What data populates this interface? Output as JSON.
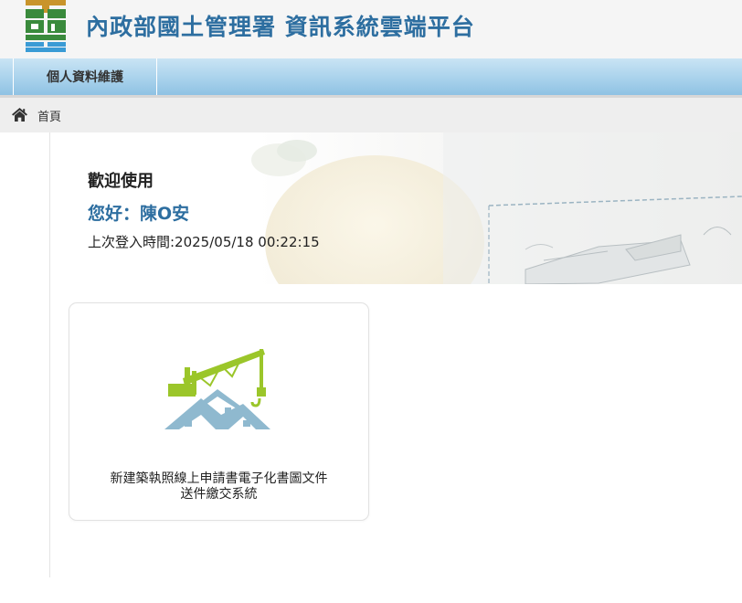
{
  "header": {
    "site_title": "內政部國土管理署 資訊系統雲端平台",
    "logo_icon": "ministry-logo-icon"
  },
  "nav": {
    "items": [
      {
        "label": "個人資料維護"
      }
    ]
  },
  "breadcrumb": {
    "home_icon": "home-icon",
    "home_label": "首頁"
  },
  "welcome": {
    "heading": "歡迎使用",
    "greeting": "您好：陳O安",
    "last_login": "上次登入時間:2025/05/18 00:22:15"
  },
  "systems": [
    {
      "icon": "construction-crane-house-icon",
      "title_line1": "新建築執照線上申請書電子化書圖文件",
      "title_line2": "送件繳交系統"
    }
  ],
  "colors": {
    "title_blue": "#2d6ea0",
    "nav_gradient_top": "#c9e4f4",
    "nav_gradient_bottom": "#8fc2e3",
    "crane_green": "#9bc62a",
    "roof_blue": "#8fb9cf"
  }
}
